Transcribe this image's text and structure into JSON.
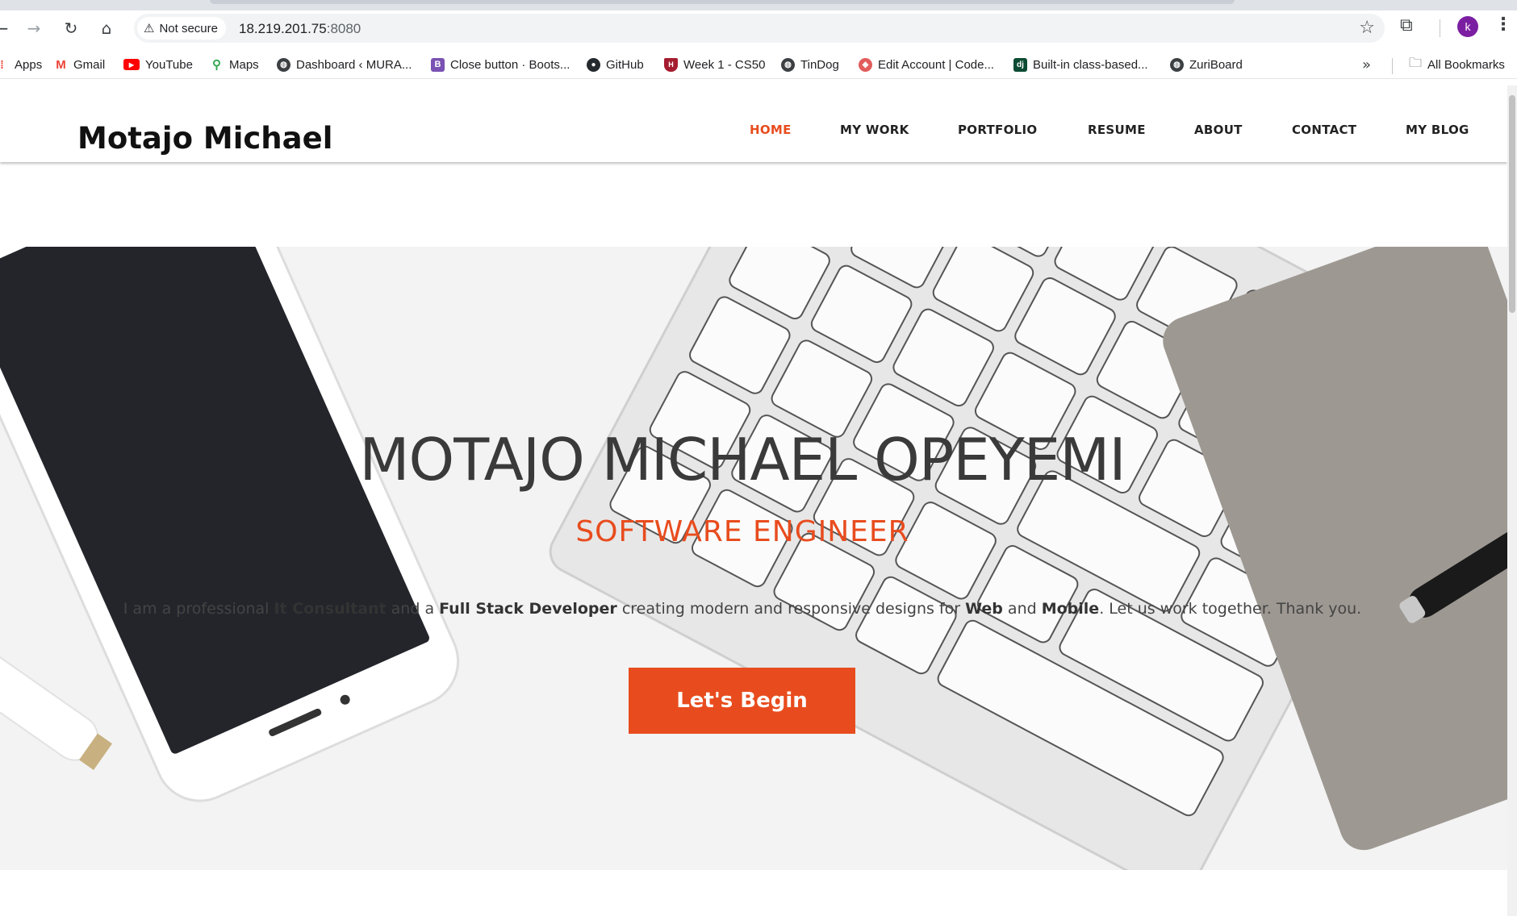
{
  "browser": {
    "security_label": "Not secure",
    "url_host": "18.219.201.75",
    "url_port": ":8080",
    "profile_initial": "k",
    "bookmarks": [
      {
        "label": "Apps",
        "icon": "apps-grid-icon",
        "color": "#ea4335"
      },
      {
        "label": "Gmail",
        "icon": "gmail-icon",
        "color": "#ea4335"
      },
      {
        "label": "YouTube",
        "icon": "youtube-icon",
        "color": "#ff0000"
      },
      {
        "label": "Maps",
        "icon": "maps-pin-icon",
        "color": "#34a853"
      },
      {
        "label": "Dashboard ‹ MURA...",
        "icon": "globe-icon",
        "color": "#3c4043"
      },
      {
        "label": "Close button · Boots...",
        "icon": "bootstrap-icon",
        "color": "#7952b3"
      },
      {
        "label": "GitHub",
        "icon": "github-icon",
        "color": "#24292e"
      },
      {
        "label": "Week 1 - CS50",
        "icon": "harvard-shield-icon",
        "color": "#a51c30"
      },
      {
        "label": "TinDog",
        "icon": "globe-icon",
        "color": "#3c4043"
      },
      {
        "label": "Edit Account | Code...",
        "icon": "codepen-icon",
        "color": "#e25c5c"
      },
      {
        "label": "Built-in class-based...",
        "icon": "django-icon",
        "color": "#0c4b33"
      },
      {
        "label": "ZuriBoard",
        "icon": "globe-icon",
        "color": "#3c4043"
      }
    ],
    "all_bookmarks_label": "All Bookmarks"
  },
  "site": {
    "brand": "Motajo Michael",
    "accent_color": "#e84c1e",
    "nav": [
      {
        "label": "HOME",
        "active": true
      },
      {
        "label": "MY WORK",
        "active": false
      },
      {
        "label": "PORTFOLIO",
        "active": false
      },
      {
        "label": "RESUME",
        "active": false
      },
      {
        "label": "ABOUT",
        "active": false
      },
      {
        "label": "CONTACT",
        "active": false
      },
      {
        "label": "MY BLOG",
        "active": false
      }
    ]
  },
  "hero": {
    "title": "MOTAJO MICHAEL OPEYEMI",
    "subtitle": "SOFTWARE ENGINEER",
    "intro_parts": {
      "p1": "I am a professional ",
      "b1": "It Consultant",
      "p2": " and a ",
      "b2": "Full Stack Developer",
      "p3": " creating modern and responsive designs for ",
      "b3": "Web",
      "p4": " and ",
      "b4": "Mobile",
      "p5": ". Let us work together. Thank you."
    },
    "cta_label": "Let's Begin"
  }
}
